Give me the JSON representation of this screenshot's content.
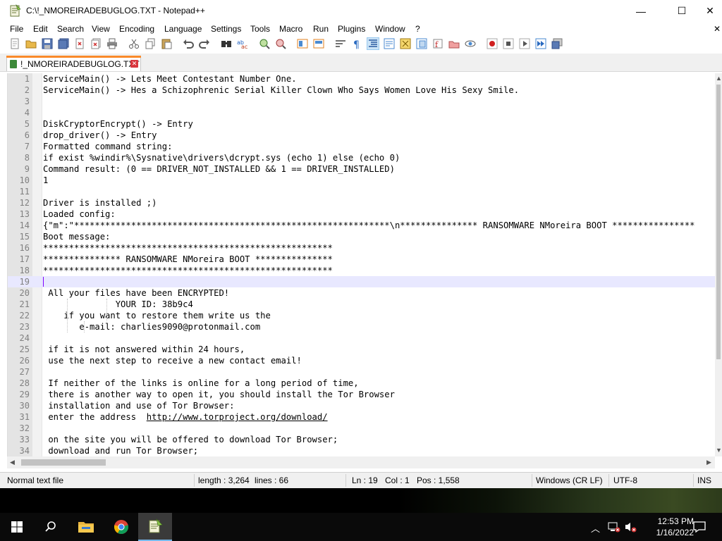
{
  "window": {
    "title": "C:\\!_NMOREIRADEBUGLOG.TXT - Notepad++",
    "controls": {
      "minimize": "—",
      "maximize": "☐",
      "close": "✕"
    }
  },
  "menu": [
    "File",
    "Edit",
    "Search",
    "View",
    "Encoding",
    "Language",
    "Settings",
    "Tools",
    "Macro",
    "Run",
    "Plugins",
    "Window",
    "?"
  ],
  "menu_extra": "✕",
  "toolbar_icons": [
    "new-file-icon",
    "open-file-icon",
    "save-icon",
    "save-all-icon",
    "close-icon",
    "close-all-icon",
    "print-icon",
    "cut-icon",
    "copy-icon",
    "paste-icon",
    "undo-icon",
    "redo-icon",
    "find-icon",
    "replace-icon",
    "zoom-in-icon",
    "zoom-out-icon",
    "sync-vertical-icon",
    "sync-horizontal-icon",
    "word-wrap-icon",
    "show-all-chars-icon",
    "indent-guide-icon",
    "language-icon",
    "doc-map-icon",
    "function-list-icon",
    "folder-workspace-icon",
    "monitoring-icon",
    "record-macro-icon",
    "stop-macro-icon",
    "play-macro-icon",
    "run-macro-multiple-icon",
    "save-macro-icon"
  ],
  "tab": {
    "label": "!_NMOREIRADEBUGLOG.TXT",
    "close": "✕"
  },
  "editor": {
    "current_line": 19,
    "lines": [
      {
        "n": "1",
        "text": "ServiceMain() -> Lets Meet Contestant Number One."
      },
      {
        "n": "2",
        "text": "ServiceMain() -> Hes a Schizophrenic Serial Killer Clown Who Says Women Love His Sexy Smile."
      },
      {
        "n": "3",
        "text": ""
      },
      {
        "n": "4",
        "text": ""
      },
      {
        "n": "5",
        "text": "DiskCryptorEncrypt() -> Entry"
      },
      {
        "n": "6",
        "text": "drop_driver() -> Entry"
      },
      {
        "n": "7",
        "text": "Formatted command string:"
      },
      {
        "n": "8",
        "text": "if exist %windir%\\Sysnative\\drivers\\dcrypt.sys (echo 1) else (echo 0)"
      },
      {
        "n": "9",
        "text": "Command result: (0 == DRIVER_NOT_INSTALLED && 1 == DRIVER_INSTALLED)"
      },
      {
        "n": "10",
        "text": "1"
      },
      {
        "n": "11",
        "text": ""
      },
      {
        "n": "12",
        "text": "Driver is installed ;)"
      },
      {
        "n": "13",
        "text": "Loaded config:"
      },
      {
        "n": "14",
        "text": "{\"m\":\"*************************************************************\\n*************** RANSOMWARE NMoreira BOOT ****************"
      },
      {
        "n": "15",
        "text": "Boot message:"
      },
      {
        "n": "16",
        "text": "********************************************************"
      },
      {
        "n": "17",
        "text": "*************** RANSOMWARE NMoreira BOOT ***************"
      },
      {
        "n": "18",
        "text": "********************************************************"
      },
      {
        "n": "19",
        "text": ""
      },
      {
        "n": "20",
        "text": " All your files have been ENCRYPTED!"
      },
      {
        "n": "21",
        "text": "              YOUR ID: 38b9c4"
      },
      {
        "n": "22",
        "text": "    if you want to restore them write us the"
      },
      {
        "n": "23",
        "text": "       e-mail: charlies9090@protonmail.com"
      },
      {
        "n": "24",
        "text": ""
      },
      {
        "n": "25",
        "text": " if it is not answered within 24 hours,"
      },
      {
        "n": "26",
        "text": " use the next step to receive a new contact email!"
      },
      {
        "n": "27",
        "text": ""
      },
      {
        "n": "28",
        "text": " If neither of the links is online for a long period of time,"
      },
      {
        "n": "29",
        "text": " there is another way to open it, you should install the Tor Browser"
      },
      {
        "n": "30",
        "text": " installation and use of Tor Browser:"
      },
      {
        "n": "31",
        "text": " enter the address  ",
        "link": "http://www.torproject.org/download/"
      },
      {
        "n": "32",
        "text": ""
      },
      {
        "n": "33",
        "text": " on the site you will be offered to download Tor Browser;"
      },
      {
        "n": "34",
        "text": " download and run Tor Browser;"
      }
    ]
  },
  "status": {
    "type": "Normal text file",
    "length": "length : 3,264",
    "lines": "lines : 66",
    "ln": "Ln : 19",
    "col": "Col : 1",
    "pos": "Pos : 1,558",
    "eol": "Windows (CR LF)",
    "encoding": "UTF-8",
    "mode": "INS"
  },
  "taskbar": {
    "time": "12:53 PM",
    "date": "1/16/2022",
    "apps": [
      "start-icon",
      "search-icon",
      "file-explorer-icon",
      "chrome-icon",
      "notepadpp-icon"
    ]
  }
}
